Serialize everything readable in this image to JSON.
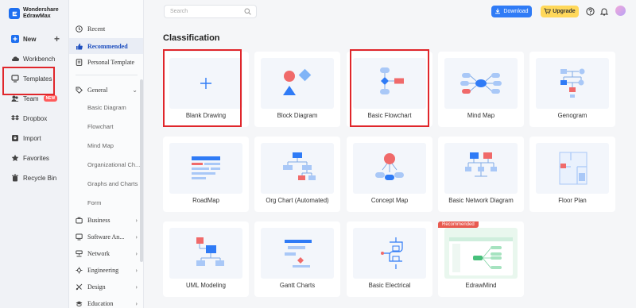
{
  "app": {
    "brand_line1": "Wondershare",
    "brand_line2": "EdrawMax"
  },
  "leftnav": {
    "new_label": "New",
    "items": [
      {
        "label": "Workbench",
        "icon": "cloud-icon"
      },
      {
        "label": "Templates",
        "icon": "templates-icon"
      },
      {
        "label": "Team",
        "icon": "team-icon",
        "badge": "NEW"
      },
      {
        "label": "Dropbox",
        "icon": "dropbox-icon"
      },
      {
        "label": "Import",
        "icon": "import-icon"
      },
      {
        "label": "Favorites",
        "icon": "star-icon"
      },
      {
        "label": "Recycle Bin",
        "icon": "trash-icon"
      }
    ]
  },
  "catcol": {
    "top": [
      {
        "label": "Recent",
        "icon": "clock-icon"
      },
      {
        "label": "Recommended",
        "icon": "thumbsup-icon"
      },
      {
        "label": "Personal Template",
        "icon": "doc-icon"
      }
    ],
    "general_label": "General",
    "general_sub": [
      "Basic Diagram",
      "Flowchart",
      "Mind Map",
      "Organizational Ch...",
      "Graphs and Charts",
      "Form"
    ],
    "groups": [
      {
        "label": "Business",
        "icon": "business-icon"
      },
      {
        "label": "Software An...",
        "icon": "software-icon"
      },
      {
        "label": "Network",
        "icon": "network-icon"
      },
      {
        "label": "Engineering",
        "icon": "engineering-icon"
      },
      {
        "label": "Design",
        "icon": "design-icon"
      },
      {
        "label": "Education",
        "icon": "education-icon"
      }
    ]
  },
  "topbar": {
    "search_placeholder": "Search",
    "download_label": "Download",
    "upgrade_label": "Upgrade"
  },
  "main": {
    "title": "Classification",
    "cards": [
      {
        "label": "Blank Drawing"
      },
      {
        "label": "Block Diagram"
      },
      {
        "label": "Basic Flowchart"
      },
      {
        "label": "Mind Map"
      },
      {
        "label": "Genogram"
      },
      {
        "label": "RoadMap"
      },
      {
        "label": "Org Chart (Automated)"
      },
      {
        "label": "Concept Map"
      },
      {
        "label": "Basic Network Diagram"
      },
      {
        "label": "Floor Plan"
      },
      {
        "label": "UML Modeling"
      },
      {
        "label": "Gantt Charts"
      },
      {
        "label": "Basic Electrical"
      },
      {
        "label": "EdrawMind",
        "badge": "Recommended"
      }
    ]
  },
  "colors": {
    "accent": "#1e6ff0",
    "highlight_frame": "#e0262b",
    "upgrade": "#ffd85a"
  }
}
